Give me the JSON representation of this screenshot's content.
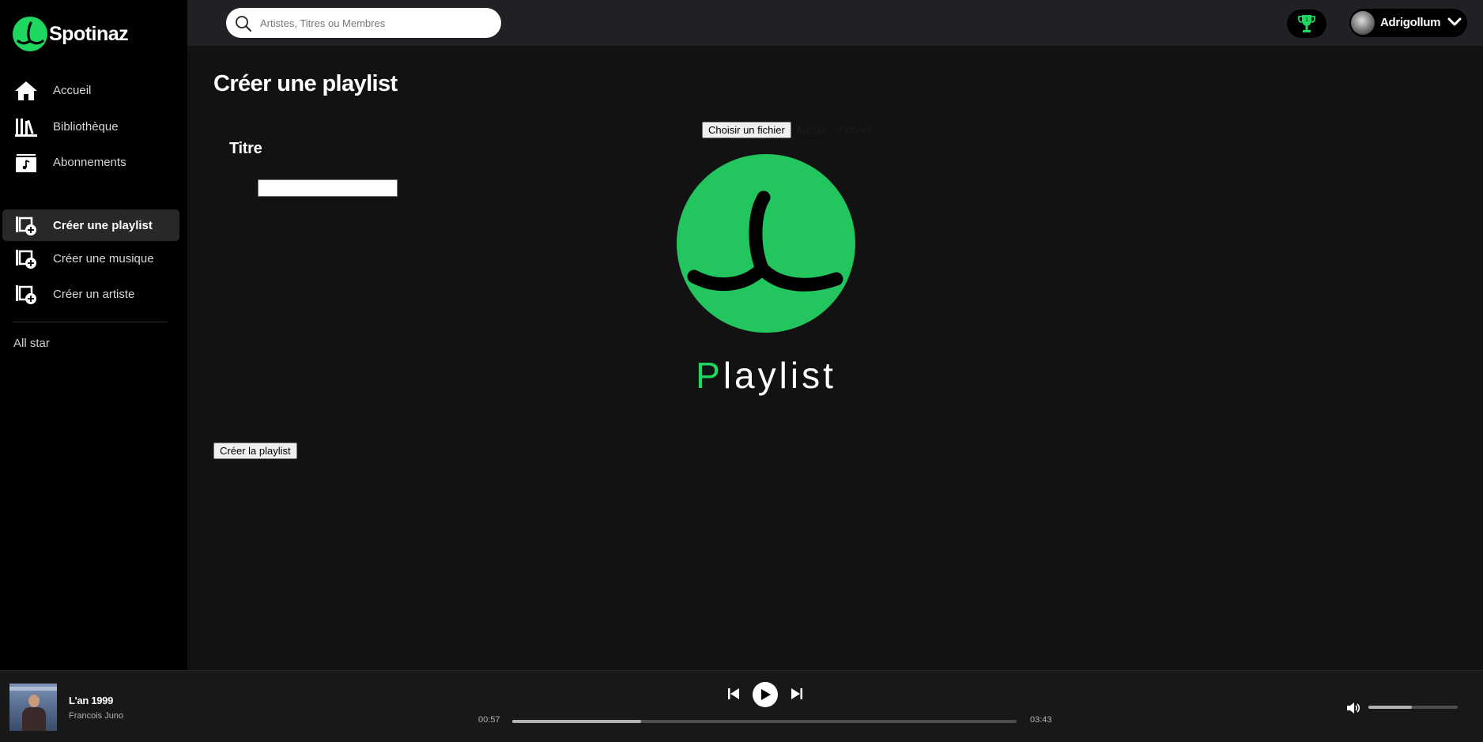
{
  "app": {
    "name": "Spotinaz",
    "accent_color": "#1ed760"
  },
  "sidebar": {
    "items": [
      {
        "label": "Accueil",
        "icon": "home-icon"
      },
      {
        "label": "Bibliothèque",
        "icon": "library-icon"
      },
      {
        "label": "Abonnements",
        "icon": "music-note-icon"
      },
      {
        "label": "Créer une playlist",
        "icon": "add-playlist-icon",
        "active": true
      },
      {
        "label": "Créer une musique",
        "icon": "add-music-icon"
      },
      {
        "label": "Créer un artiste",
        "icon": "add-artist-icon"
      }
    ],
    "extra": "All star"
  },
  "topbar": {
    "search_placeholder": "Artistes, Titres ou Membres",
    "trophy_icon": "trophy-icon",
    "user": {
      "name": "Adrigollum"
    }
  },
  "main": {
    "title": "Créer une playlist",
    "field_label": "Titre",
    "title_value": "",
    "file_button": "Choisir un fichier",
    "file_status": "Aucun ... r choisi",
    "cover": {
      "title_first": "P",
      "title_rest": "laylist"
    },
    "submit_label": "Créer la playlist"
  },
  "player": {
    "track_title": "L'an 1999",
    "artist": "Francois Juno",
    "current_time": "00:57",
    "total_time": "03:43",
    "progress": 0.256,
    "volume": 0.49
  }
}
